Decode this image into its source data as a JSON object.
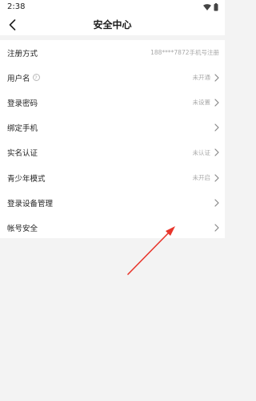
{
  "status_bar": {
    "time": "2:38"
  },
  "header": {
    "title": "安全中心"
  },
  "rows": [
    {
      "label": "注册方式",
      "value": "188****7872手机号注册",
      "has_help": false,
      "has_chevron": false
    },
    {
      "label": "用户名",
      "value": "未开通",
      "has_help": true,
      "has_chevron": true
    },
    {
      "label": "登录密码",
      "value": "未设置",
      "has_help": false,
      "has_chevron": true
    },
    {
      "label": "绑定手机",
      "value": "",
      "has_help": false,
      "has_chevron": true
    },
    {
      "label": "实名认证",
      "value": "未认证",
      "has_help": false,
      "has_chevron": true
    },
    {
      "label": "青少年模式",
      "value": "未开启",
      "has_help": false,
      "has_chevron": true
    },
    {
      "label": "登录设备管理",
      "value": "",
      "has_help": false,
      "has_chevron": true
    },
    {
      "label": "帐号安全",
      "value": "",
      "has_help": false,
      "has_chevron": true
    }
  ],
  "colors": {
    "arrow": "#e8352b",
    "background": "#f3f3f3",
    "value_text": "#a8a8a8"
  }
}
